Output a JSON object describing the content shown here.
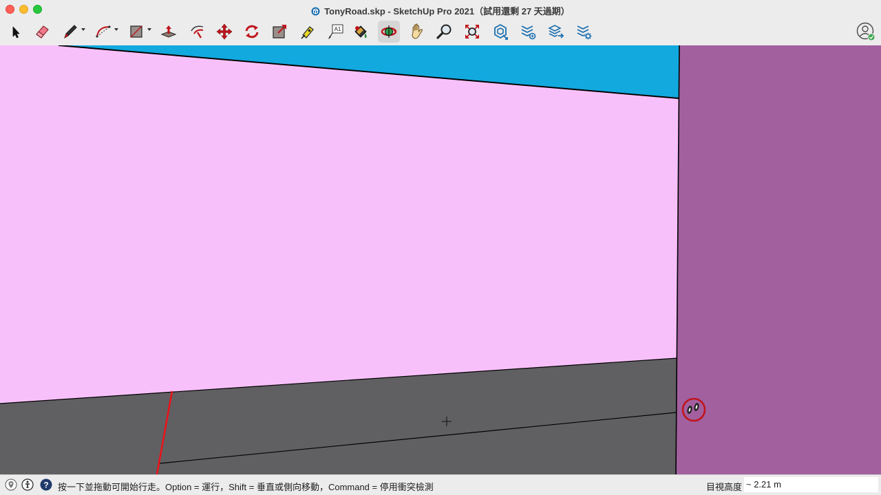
{
  "window": {
    "title": "TonyRoad.skp - SketchUp Pro 2021（試用還剩 27 天過期）"
  },
  "toolbar": {
    "tools": [
      {
        "name": "select-icon",
        "active": false
      },
      {
        "name": "eraser-icon",
        "active": false
      },
      {
        "name": "line-pencil-icon",
        "active": false
      },
      {
        "name": "arc-icon",
        "active": false
      },
      {
        "name": "rectangle-icon",
        "active": false
      },
      {
        "name": "push-pull-icon",
        "active": false
      },
      {
        "name": "offset-icon",
        "active": false
      },
      {
        "name": "move-icon",
        "active": false
      },
      {
        "name": "rotate-icon",
        "active": false
      },
      {
        "name": "scale-icon",
        "active": false
      },
      {
        "name": "tape-measure-icon",
        "active": false
      },
      {
        "name": "text-icon",
        "active": false
      },
      {
        "name": "paint-bucket-icon",
        "active": false
      },
      {
        "name": "orbit-icon",
        "active": true
      },
      {
        "name": "pan-icon",
        "active": false
      },
      {
        "name": "zoom-icon",
        "active": false
      },
      {
        "name": "zoom-extents-icon",
        "active": false
      },
      {
        "name": "3d-warehouse-icon",
        "active": false
      },
      {
        "name": "extension-warehouse-icon",
        "active": false
      },
      {
        "name": "layout-send-icon",
        "active": false
      },
      {
        "name": "extension-manager-icon",
        "active": false
      }
    ],
    "text_tool_label": "A1"
  },
  "colors": {
    "sky": "#12a9df",
    "wall_front": "#f8c0fa",
    "wall_side": "#a2609f",
    "ground": "#606063",
    "edge": "#000000",
    "red_axis": "#e8141a",
    "accent_red": "#c0141c"
  },
  "statusbar": {
    "hint": "按一下並拖動可開始行走。Option = 運行，Shift = 垂直或側向移動，Command = 停用衝突檢測",
    "measure_label": "目視高度",
    "measure_value": "~ 2.21 m"
  }
}
